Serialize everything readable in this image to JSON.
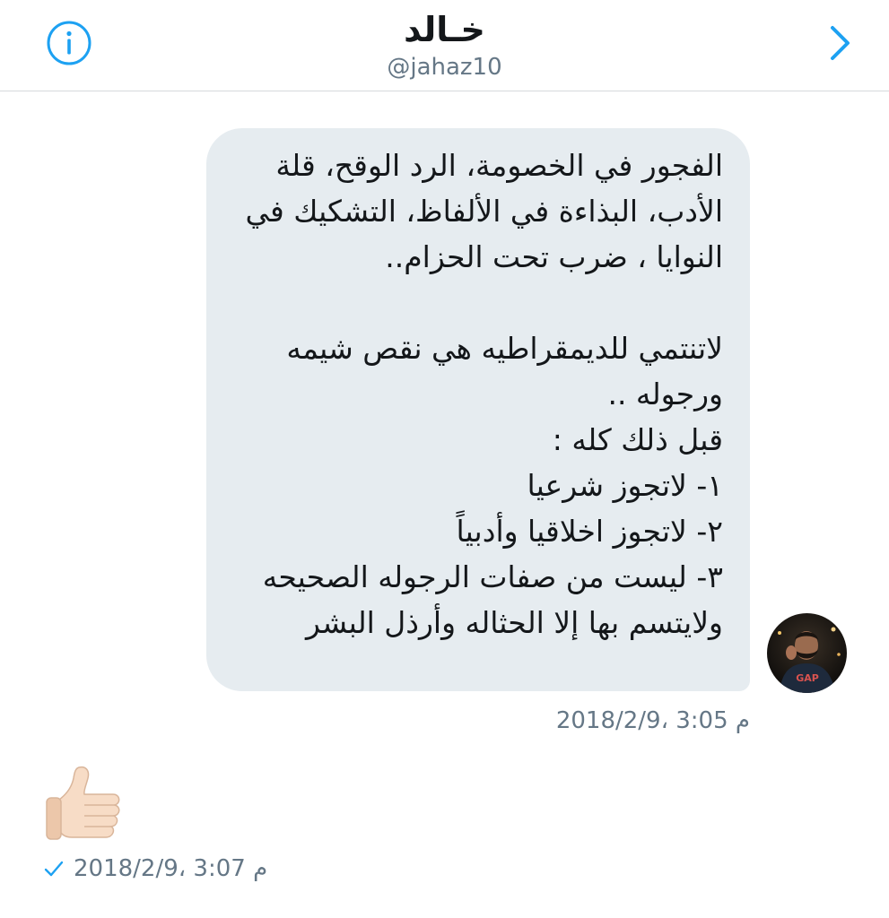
{
  "header": {
    "title": "خـالد",
    "handle": "@jahaz10",
    "info_icon": "info-circle-icon",
    "back_icon": "chevron-right-icon"
  },
  "conversation": {
    "received_message": {
      "text": "الفجور في الخصومة، الرد الوقح، قلة الأدب، البذاءة في الألفاظ، التشكيك في النوايا ، ضرب تحت الحزام..\n\nلاتنتمي للديمقراطيه هي نقص شيمه ورجوله ..\nقبل ذلك كله :\n١- لاتجوز شرعيا\n٢- لاتجوز اخلاقيا وأدبياً\n٣- ليست من صفات الرجوله الصحيحه\nولايتسم بها إلا الحثاله وأرذل البشر",
      "timestamp": "2018/2/9، 3:05 م"
    },
    "sent_message": {
      "emoji": "thumbs-up-icon",
      "timestamp": "2018/2/9، 3:07 م",
      "status_icon": "checkmark-icon"
    }
  },
  "colors": {
    "accent": "#1da1f2",
    "bubble_bg": "#e6ecf0",
    "secondary_text": "#657786",
    "primary_text": "#14171a",
    "divider": "#d6d9dc"
  }
}
